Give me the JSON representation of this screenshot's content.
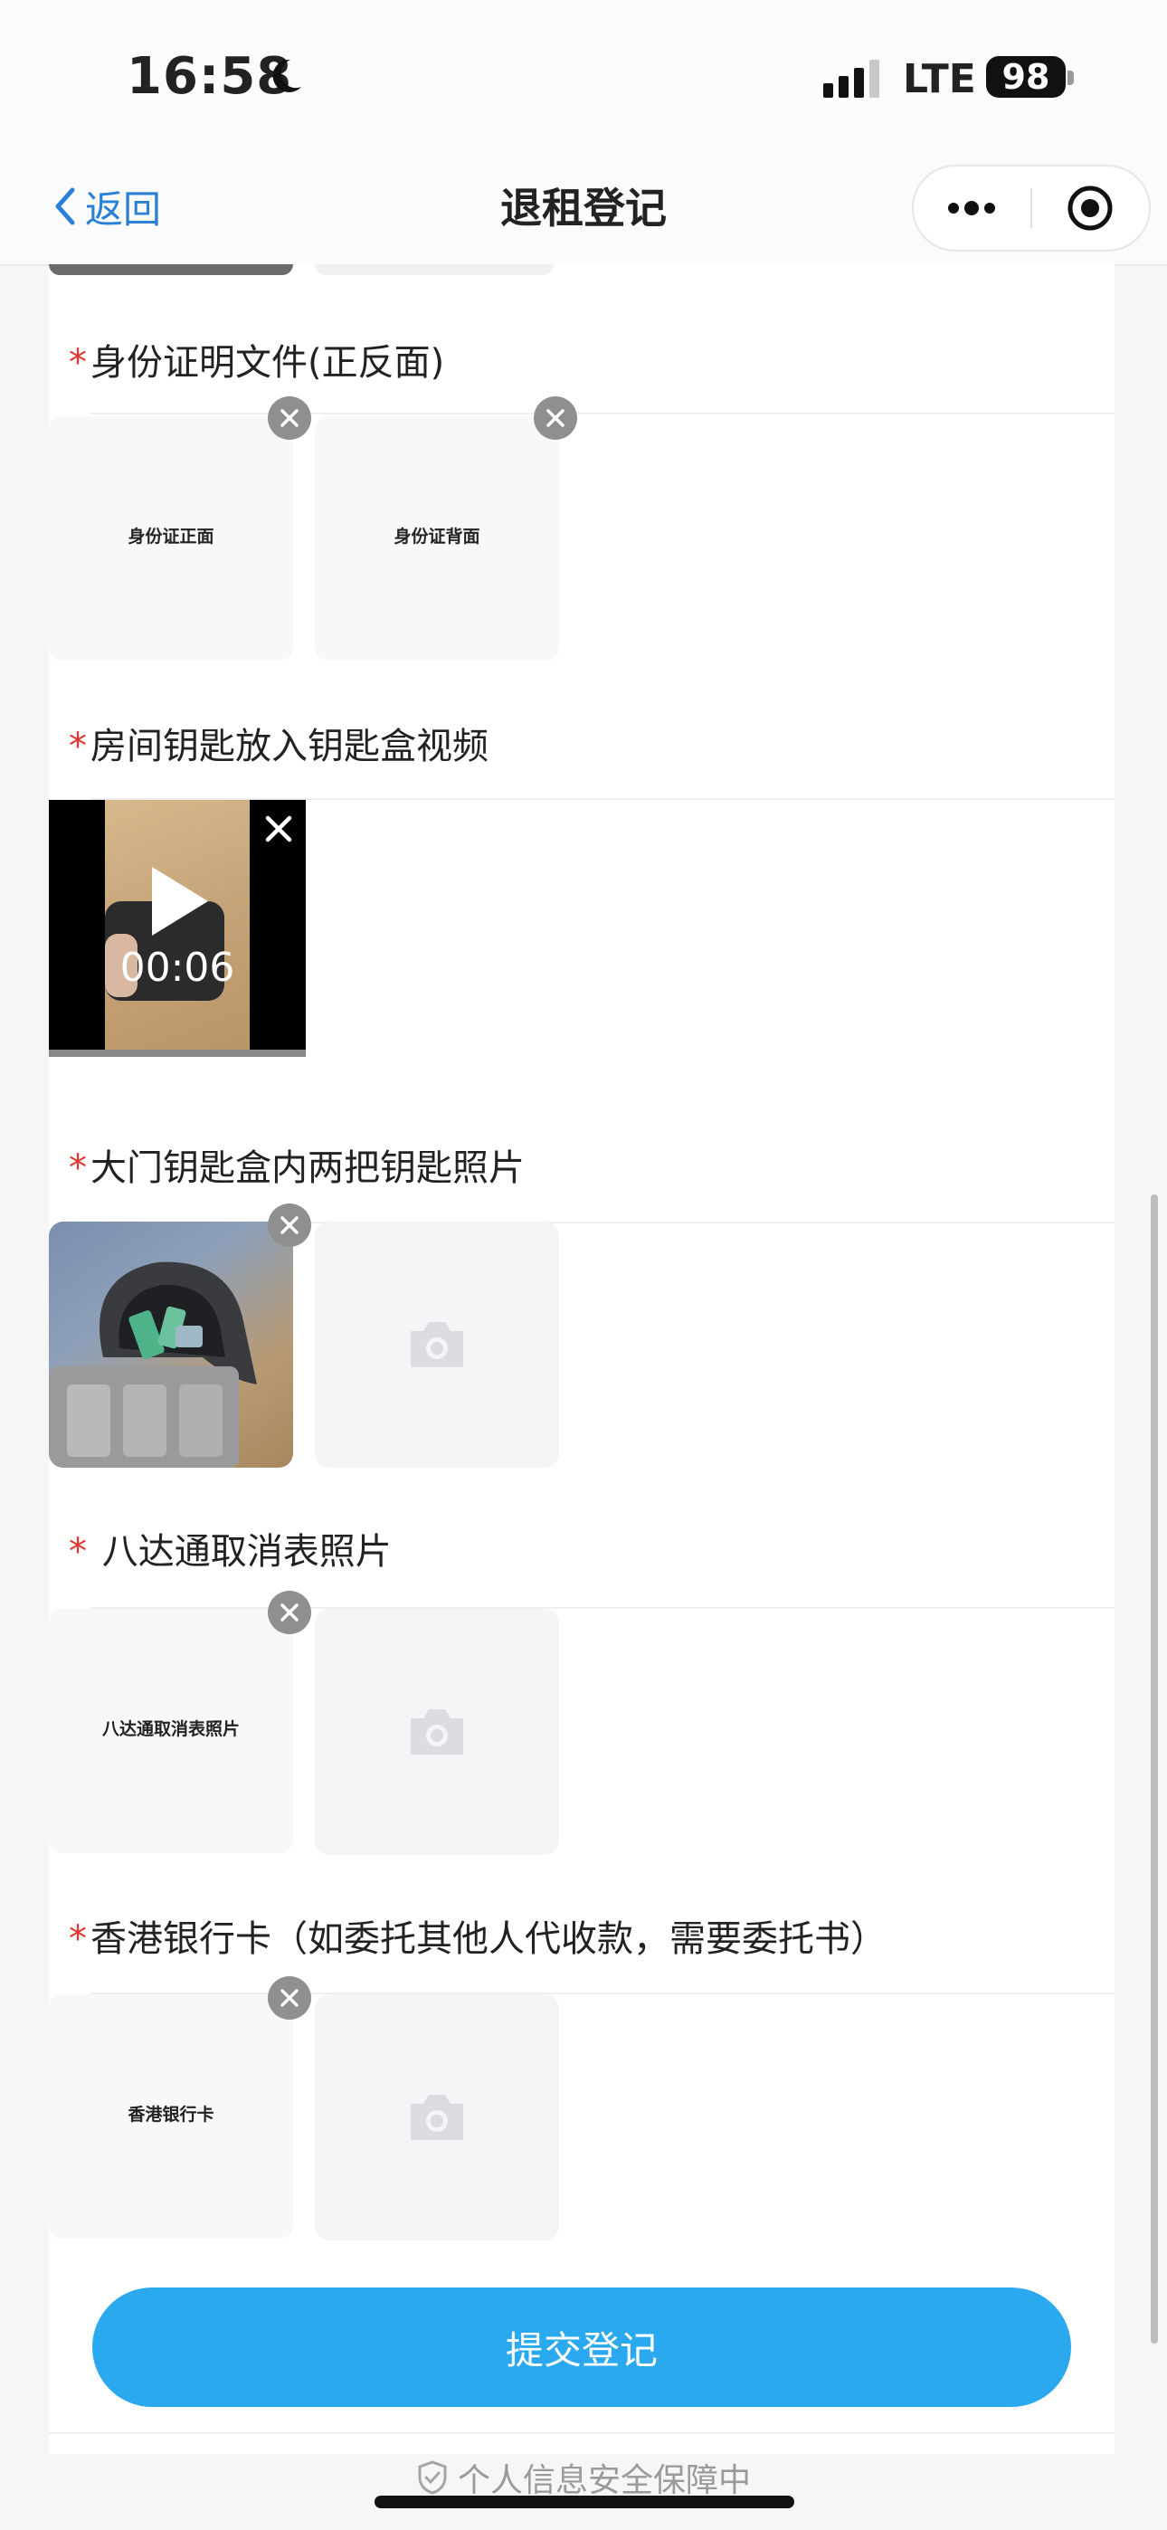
{
  "status_bar": {
    "time": "16:58",
    "network": "LTE",
    "battery": "98"
  },
  "nav": {
    "back_label": "返回",
    "title": "退租登记"
  },
  "sections": [
    {
      "label": "身份证明文件(正反面)",
      "images": [
        "身份证正面",
        "身份证背面"
      ]
    },
    {
      "label": "房间钥匙放入钥匙盒视频",
      "video_duration": "00:06"
    },
    {
      "label": "大门钥匙盒内两把钥匙照片"
    },
    {
      "label": "八达通取消表照片",
      "images": [
        "八达通取消表照片"
      ]
    },
    {
      "label": "香港银行卡（如委托其他人代收款，需要委托书）",
      "images": [
        "香港银行卡"
      ]
    }
  ],
  "required_mark": "*",
  "submit_label": "提交登记",
  "security_note": "个人信息安全保障中",
  "colors": {
    "accent": "#2aa9ef",
    "link": "#2a7fd6",
    "required": "#e3342f"
  },
  "icons": [
    "moon-icon",
    "signal-icon",
    "back-chevron-icon",
    "more-icon",
    "close-target-icon",
    "remove-icon",
    "play-icon",
    "camera-icon",
    "shield-icon"
  ]
}
